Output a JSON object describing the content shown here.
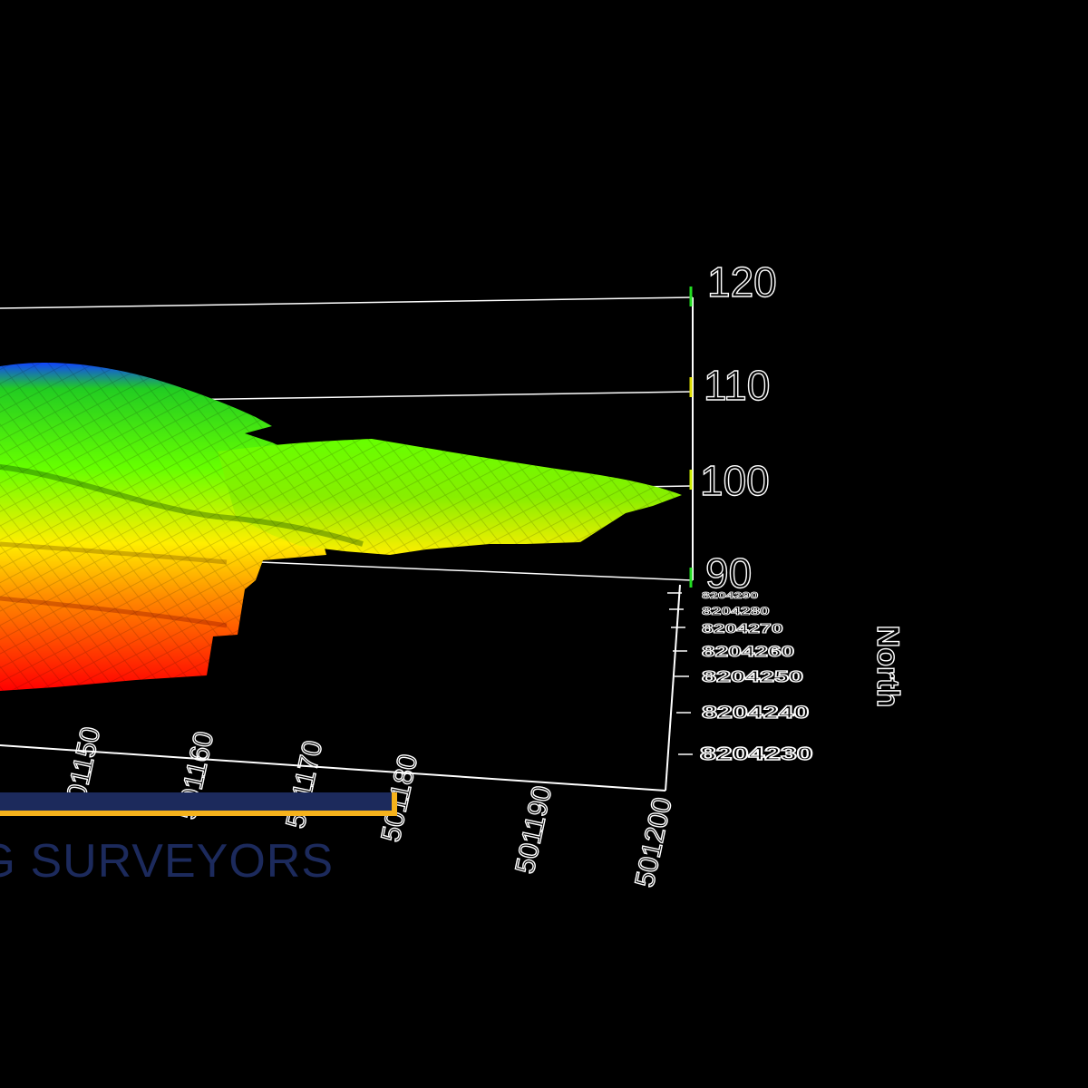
{
  "chart_data": {
    "type": "surface-3d",
    "title": "",
    "zlabel": "",
    "zlim": [
      90,
      120
    ],
    "z_ticks": [
      "90",
      "100",
      "110",
      "120"
    ],
    "y_label": "North",
    "y_ticks": [
      "8204230",
      "8204240",
      "8204250",
      "8204260",
      "8204270",
      "8204280",
      "8204290"
    ],
    "x_ticks": [
      "501150",
      "501160",
      "501170",
      "501180",
      "501190",
      "501200"
    ],
    "colormap": [
      "#ff0000",
      "#ff8800",
      "#ffee00",
      "#66ff00",
      "#22cc22",
      "#1144ff"
    ],
    "background": "#000000",
    "grid": true
  },
  "overlay": {
    "company_text": "NG SURVEYORS",
    "bar_color": "#1c2a5c",
    "bar_accent": "#f5b21c"
  }
}
